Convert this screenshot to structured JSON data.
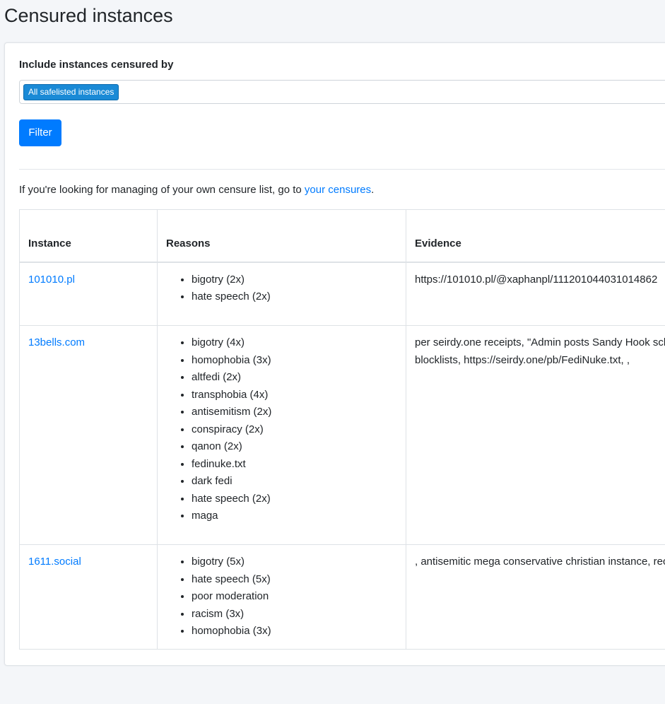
{
  "page": {
    "title": "Censured instances"
  },
  "filter": {
    "label": "Include instances censured by",
    "selected_tag": "All safelisted instances",
    "button_label": "Filter"
  },
  "info": {
    "text_before": "If you're looking for managing of your own censure list, go to ",
    "link_text": "your censures",
    "text_after": "."
  },
  "table": {
    "headers": {
      "instance": "Instance",
      "reasons": "Reasons",
      "evidence": "Evidence"
    },
    "rows": [
      {
        "instance": "101010.pl",
        "reasons": [
          "bigotry (2x)",
          "hate speech (2x)"
        ],
        "evidence": [
          "https://101010.pl/@xaphanpl/111201044031014862"
        ]
      },
      {
        "instance": "13bells.com",
        "reasons": [
          "bigotry (4x)",
          "homophobia (3x)",
          "altfedi (2x)",
          "transphobia (4x)",
          "antisemitism (2x)",
          "conspiracy (2x)",
          "qanon (2x)",
          "fedinuke.txt",
          "dark fedi",
          "hate speech (2x)",
          "maga"
        ],
        "evidence": [
          "per seirdy.one receipts, \"Admin posts Sandy Hook sch",
          "blocklists, https://seirdy.one/pb/FediNuke.txt, ,"
        ]
      },
      {
        "instance": "1611.social",
        "reasons": [
          "bigotry (5x)",
          "hate speech (5x)",
          "poor moderation",
          "racism (3x)",
          "homophobia (3x)"
        ],
        "evidence": [
          ", antisemitic mega conservative christian instance, rec"
        ]
      }
    ]
  }
}
